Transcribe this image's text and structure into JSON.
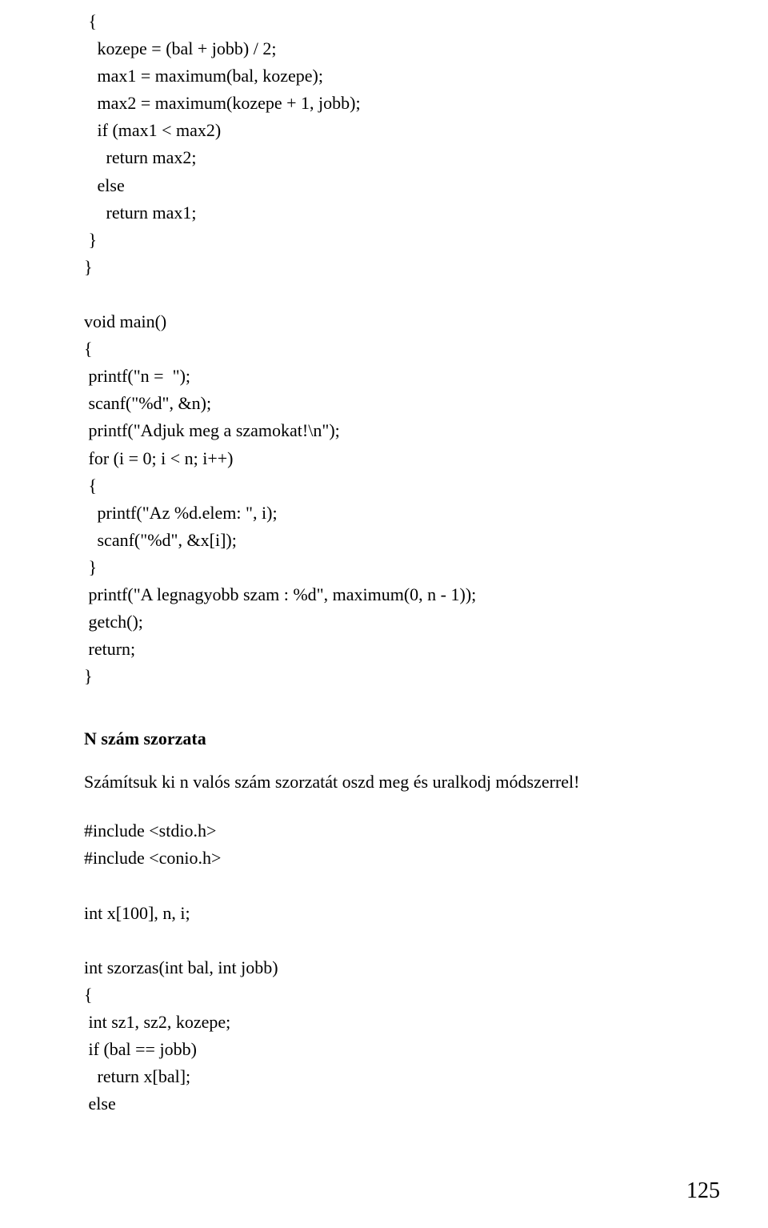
{
  "code_block_1": " {\n   kozepe = (bal + jobb) / 2;\n   max1 = maximum(bal, kozepe);\n   max2 = maximum(kozepe + 1, jobb);\n   if (max1 < max2)\n     return max2;\n   else\n     return max1;\n }\n}\n\nvoid main()\n{\n printf(\"n =  \");\n scanf(\"%d\", &n);\n printf(\"Adjuk meg a szamokat!\\n\");\n for (i = 0; i < n; i++)\n {\n   printf(\"Az %d.elem: \", i);\n   scanf(\"%d\", &x[i]);\n }\n printf(\"A legnagyobb szam : %d\", maximum(0, n - 1));\n getch();\n return;\n}",
  "section_heading": "N szám szorzata",
  "paragraph": "Számítsuk ki n valós szám szorzatát oszd meg és uralkodj módszerrel!",
  "code_block_2": "#include <stdio.h>\n#include <conio.h>\n\nint x[100], n, i;\n\nint szorzas(int bal, int jobb)\n{\n int sz1, sz2, kozepe;\n if (bal == jobb)\n   return x[bal];\n else",
  "page_number": "125"
}
